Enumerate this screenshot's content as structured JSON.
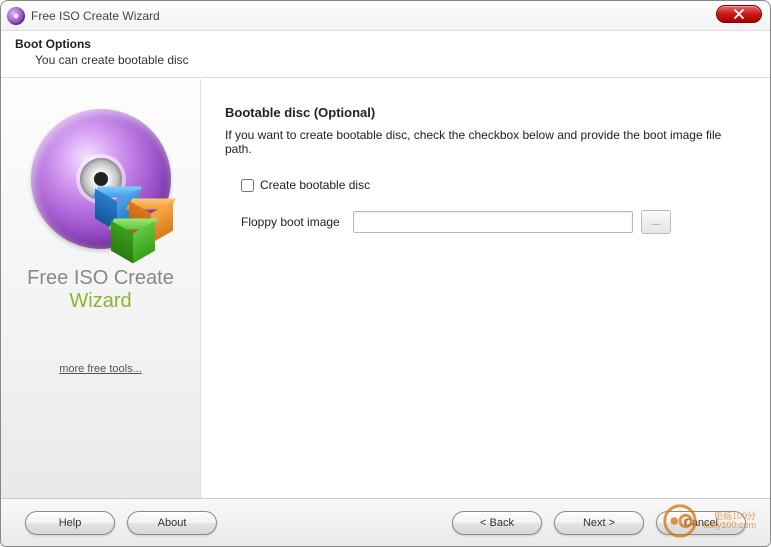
{
  "window": {
    "title": "Free ISO Create Wizard"
  },
  "header": {
    "title": "Boot Options",
    "subtitle": "You can create bootable disc"
  },
  "sidebar": {
    "product_line1": "Free ISO Create",
    "product_line2": "Wizard",
    "more_link": "more free tools..."
  },
  "main": {
    "section_title": "Bootable disc (Optional)",
    "section_desc": "If you want to create bootable disc, check the checkbox below and provide the boot image file path.",
    "checkbox_label": "Create bootable disc",
    "checkbox_checked": false,
    "field_label": "Floppy boot image",
    "field_value": "",
    "browse_label": "..."
  },
  "footer": {
    "help": "Help",
    "about": "About",
    "back": "< Back",
    "next": "Next >",
    "cancel": "Cancel"
  },
  "watermark": {
    "line1": "电脑100分",
    "line2": "dally100.com"
  }
}
